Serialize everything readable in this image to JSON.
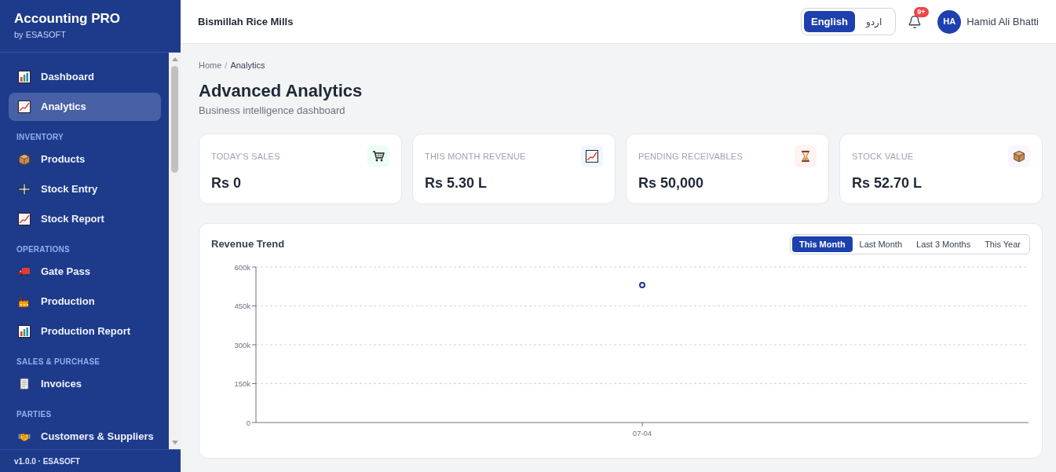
{
  "sidebar": {
    "brand": {
      "title": "Accounting PRO",
      "subtitle": "by ESASOFT"
    },
    "nav": [
      {
        "kind": "item",
        "label": "Dashboard",
        "selected": false
      },
      {
        "kind": "item",
        "label": "Analytics",
        "selected": true
      },
      {
        "kind": "heading",
        "label": "INVENTORY"
      },
      {
        "kind": "item",
        "label": "Products",
        "selected": false
      },
      {
        "kind": "item",
        "label": "Stock Entry",
        "selected": false
      },
      {
        "kind": "item",
        "label": "Stock Report",
        "selected": false
      },
      {
        "kind": "heading",
        "label": "OPERATIONS"
      },
      {
        "kind": "item",
        "label": "Gate Pass",
        "selected": false
      },
      {
        "kind": "item",
        "label": "Production",
        "selected": false
      },
      {
        "kind": "item",
        "label": "Production Report",
        "selected": false
      },
      {
        "kind": "heading",
        "label": "SALES & PURCHASE"
      },
      {
        "kind": "item",
        "label": "Invoices",
        "selected": false
      },
      {
        "kind": "heading",
        "label": "PARTIES"
      },
      {
        "kind": "item",
        "label": "Customers & Suppliers",
        "selected": false
      }
    ],
    "footer": "v1.0.0 · ESASOFT"
  },
  "top_bar": {
    "company": "Bismillah Rice Mills",
    "language_toggle": [
      {
        "label": "English",
        "selected": true
      },
      {
        "label": "اردو",
        "selected": false
      }
    ],
    "notifications": {
      "badge": "9+"
    },
    "user": {
      "initials": "HA",
      "name": "Hamid Ali Bhatti"
    }
  },
  "breadcrumb": {
    "separator": "/",
    "items": [
      {
        "label": "Home",
        "current": false
      },
      {
        "label": "Analytics",
        "current": true
      }
    ]
  },
  "page": {
    "title": "Advanced Analytics",
    "subtitle": "Business intelligence dashboard"
  },
  "stat_cards": [
    {
      "label": "TODAY'S SALES",
      "value": "Rs 0"
    },
    {
      "label": "THIS MONTH REVENUE",
      "value": "Rs 5.30 L"
    },
    {
      "label": "PENDING RECEIVABLES",
      "value": "Rs 50,000"
    },
    {
      "label": "STOCK VALUE",
      "value": "Rs 52.70 L"
    }
  ],
  "revenue_trend": {
    "title": "Revenue Trend",
    "ranges": [
      {
        "label": "This Month",
        "selected": true
      },
      {
        "label": "Last Month",
        "selected": false
      },
      {
        "label": "Last 3 Months",
        "selected": false
      },
      {
        "label": "This Year",
        "selected": false
      }
    ],
    "chart_data": {
      "type": "line",
      "grid": true,
      "categories": [
        "07-04"
      ],
      "series": [
        {
          "color": "#1e3a8a",
          "marker": "o",
          "values": [
            530000
          ]
        }
      ],
      "ylim": [
        0,
        600000
      ],
      "yticks": [
        {
          "value": 0,
          "label": "0"
        },
        {
          "value": 150000,
          "label": "150k"
        },
        {
          "value": 300000,
          "label": "300k"
        },
        {
          "value": 450000,
          "label": "450k"
        },
        {
          "value": 600000,
          "label": "600k"
        }
      ]
    }
  }
}
